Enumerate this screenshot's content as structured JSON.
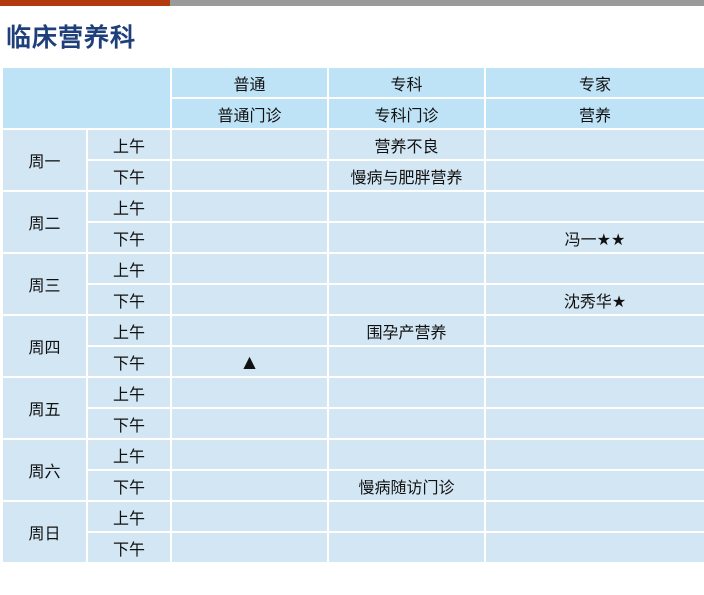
{
  "page": {
    "title": "临床营养科"
  },
  "columns": [
    {
      "type": "普通",
      "name": "普通门诊"
    },
    {
      "type": "专科",
      "name": "专科门诊"
    },
    {
      "type": "专家",
      "name": "营养"
    }
  ],
  "days": [
    {
      "label": "周一",
      "slots": [
        {
          "period": "上午",
          "cells": [
            "",
            "营养不良",
            ""
          ]
        },
        {
          "period": "下午",
          "cells": [
            "",
            "慢病与肥胖营养",
            ""
          ]
        }
      ]
    },
    {
      "label": "周二",
      "slots": [
        {
          "period": "上午",
          "cells": [
            "",
            "",
            ""
          ]
        },
        {
          "period": "下午",
          "cells": [
            "",
            "",
            "冯一★★"
          ]
        }
      ]
    },
    {
      "label": "周三",
      "slots": [
        {
          "period": "上午",
          "cells": [
            "",
            "",
            ""
          ]
        },
        {
          "period": "下午",
          "cells": [
            "",
            "",
            "沈秀华★"
          ]
        }
      ]
    },
    {
      "label": "周四",
      "slots": [
        {
          "period": "上午",
          "cells": [
            "",
            "围孕产营养",
            ""
          ]
        },
        {
          "period": "下午",
          "cells": [
            "▲",
            "",
            ""
          ]
        }
      ]
    },
    {
      "label": "周五",
      "slots": [
        {
          "period": "上午",
          "cells": [
            "",
            "",
            ""
          ]
        },
        {
          "period": "下午",
          "cells": [
            "",
            "",
            ""
          ]
        }
      ]
    },
    {
      "label": "周六",
      "slots": [
        {
          "period": "上午",
          "cells": [
            "",
            "",
            ""
          ]
        },
        {
          "period": "下午",
          "cells": [
            "",
            "慢病随访门诊",
            ""
          ]
        }
      ]
    },
    {
      "label": "周日",
      "slots": [
        {
          "period": "上午",
          "cells": [
            "",
            "",
            ""
          ]
        },
        {
          "period": "下午",
          "cells": [
            "",
            "",
            ""
          ]
        }
      ]
    }
  ]
}
